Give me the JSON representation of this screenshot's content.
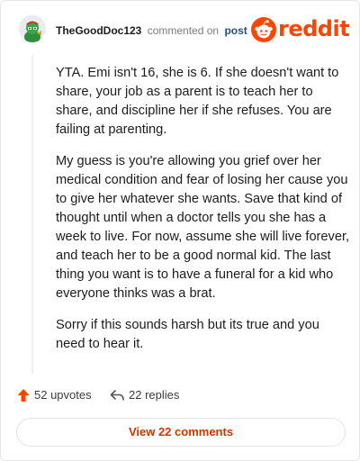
{
  "comment": {
    "username": "TheGoodDoc123",
    "action_text": "commented on",
    "post_link": "post",
    "paragraphs": [
      "YTA. Emi isn't 16, she is 6. If she doesn't want to share, your job as a parent is to teach her to share, and discipline her if she refuses. You are failing at parenting.",
      "My guess is you're allowing you grief over her medical condition and fear of losing her cause you to give her whatever she wants. Save that kind of thought until when a doctor tells you she has a week to live. For now, assume she will live forever, and teach her to be a good normal kid. The last thing you want is to have a funeral for a kid who everyone thinks was a brat.",
      "Sorry if this sounds harsh but its true and you need to hear it."
    ],
    "upvotes_label": "52 upvotes",
    "replies_label": "22 replies",
    "view_comments_label": "View 22 comments"
  },
  "brand": {
    "wordmark": "reddit",
    "color": "#ff4500"
  },
  "icons": {
    "avatar": "avatar",
    "brand_logo": "reddit-snoo-icon",
    "upvote": "upvote-arrow-icon",
    "reply": "reply-arrow-icon"
  }
}
